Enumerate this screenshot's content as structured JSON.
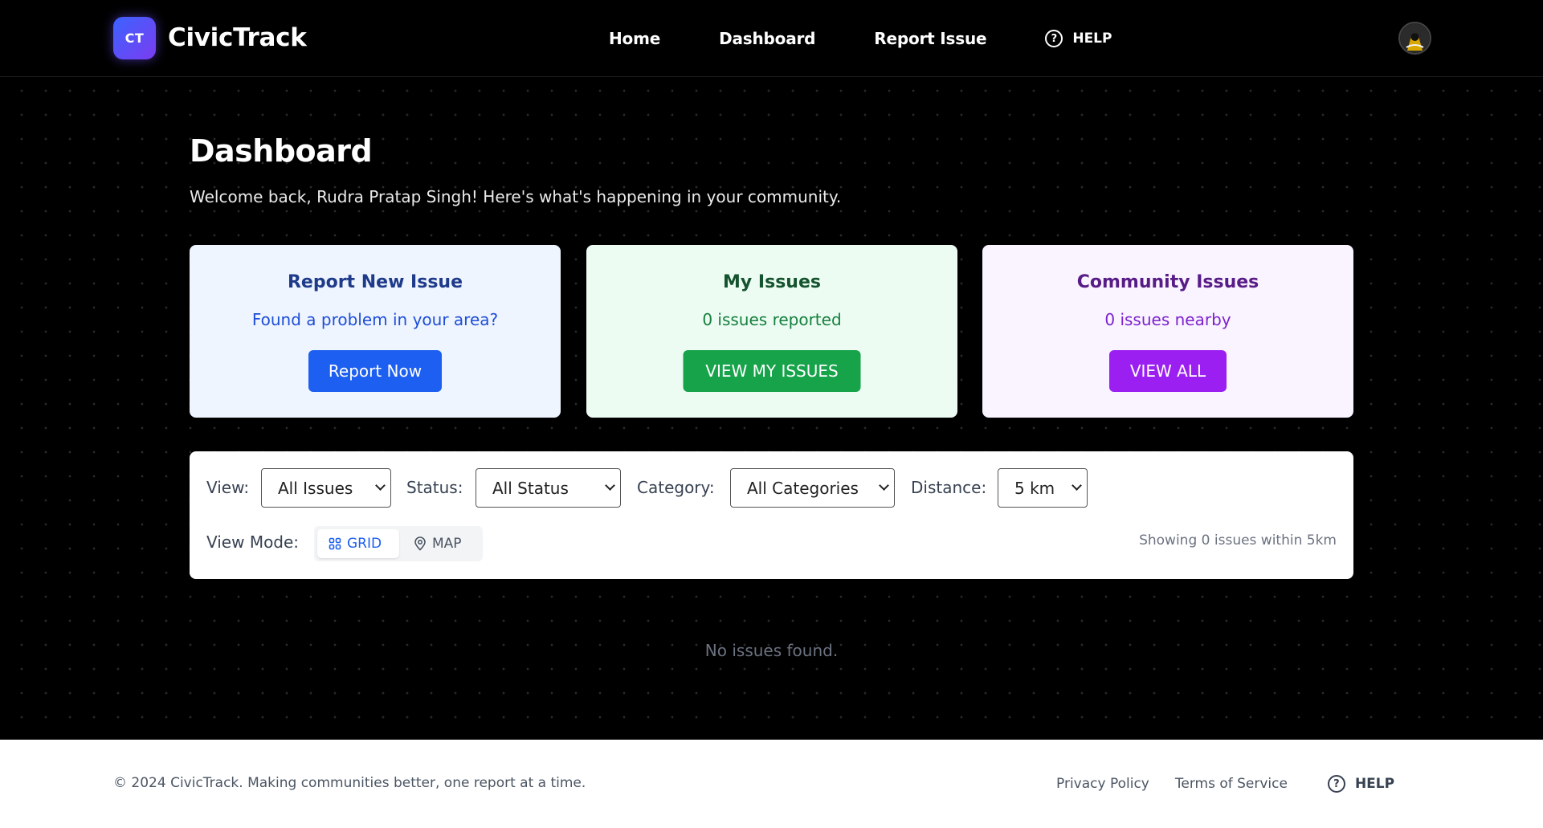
{
  "header": {
    "logo_badge": "CT",
    "logo_text": "CivicTrack",
    "nav": [
      "Home",
      "Dashboard",
      "Report Issue"
    ],
    "help_label": "HELP"
  },
  "main": {
    "title": "Dashboard",
    "welcome": "Welcome back, Rudra Pratap Singh! Here's what's happening in your community.",
    "cards": [
      {
        "title": "Report New Issue",
        "subtitle": "Found a problem in your area?",
        "button": "Report Now",
        "color": "#1d5ff0"
      },
      {
        "title": "My Issues",
        "subtitle": "0 issues reported",
        "button": "VIEW MY ISSUES",
        "color": "#16a34a"
      },
      {
        "title": "Community Issues",
        "subtitle": "0 issues nearby",
        "button": "VIEW ALL",
        "color": "#9b1ff0"
      }
    ]
  },
  "filters": {
    "view_label": "View:",
    "view_value": "All Issues",
    "status_label": "Status:",
    "status_value": "All Status",
    "category_label": "Category:",
    "category_value": "All Categories",
    "distance_label": "Distance:",
    "distance_value": "5 km",
    "view_mode_label": "View Mode:",
    "grid_label": "GRID",
    "map_label": "MAP",
    "active_mode": "grid",
    "showing": "Showing 0 issues within 5km"
  },
  "empty_state": "No issues found.",
  "footer": {
    "copyright": "© 2024 CivicTrack. Making communities better, one report at a time.",
    "privacy": "Privacy Policy",
    "terms": "Terms of Service",
    "help": "HELP"
  }
}
